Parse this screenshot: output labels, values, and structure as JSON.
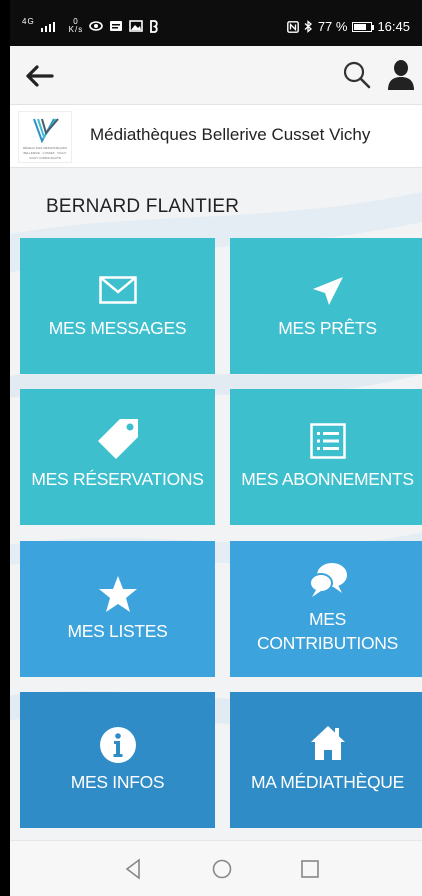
{
  "status_bar": {
    "signal_text": "4G",
    "net_speed_value": "0",
    "net_speed_unit": "K/s",
    "battery_percent": "77 %",
    "battery_level": 0.77,
    "time": "16:45"
  },
  "app_bar": {
    "back_icon": "arrow-left-icon",
    "search_icon": "search-icon",
    "account_icon": "user-icon"
  },
  "library": {
    "name": "Médiathèques Bellerive Cusset Vichy",
    "logo_line1": "RÉSEAU DES MÉDIATHÈQUES",
    "logo_line2": "BELLERIVE · CUSSET · VICHY",
    "logo_line3": "VICHY COMMUNAUTÉ"
  },
  "user": {
    "name": "BERNARD FLANTIER"
  },
  "colors": {
    "teal": "#3ebfce",
    "blue": "#3da3dc",
    "dark_blue": "#2f8cc6"
  },
  "tiles": [
    {
      "label": "MES MESSAGES",
      "icon": "envelope-icon"
    },
    {
      "label": "MES PRÊTS",
      "icon": "paper-plane-icon"
    },
    {
      "label": "MES RÉSERVATIONS",
      "icon": "tag-icon"
    },
    {
      "label": "MES ABONNEMENTS",
      "icon": "list-icon"
    },
    {
      "label": "MES LISTES",
      "icon": "star-icon"
    },
    {
      "label_line1": "MES",
      "label_line2": "CONTRIBUTIONS",
      "icon": "speech-bubbles-icon"
    },
    {
      "label": "MES INFOS",
      "icon": "info-icon"
    },
    {
      "label": "MA MÉDIATHÈQUE",
      "icon": "home-icon"
    }
  ],
  "nav_bar": {
    "back_icon": "triangle-back-icon",
    "home_icon": "circle-home-icon",
    "recents_icon": "square-recents-icon"
  }
}
